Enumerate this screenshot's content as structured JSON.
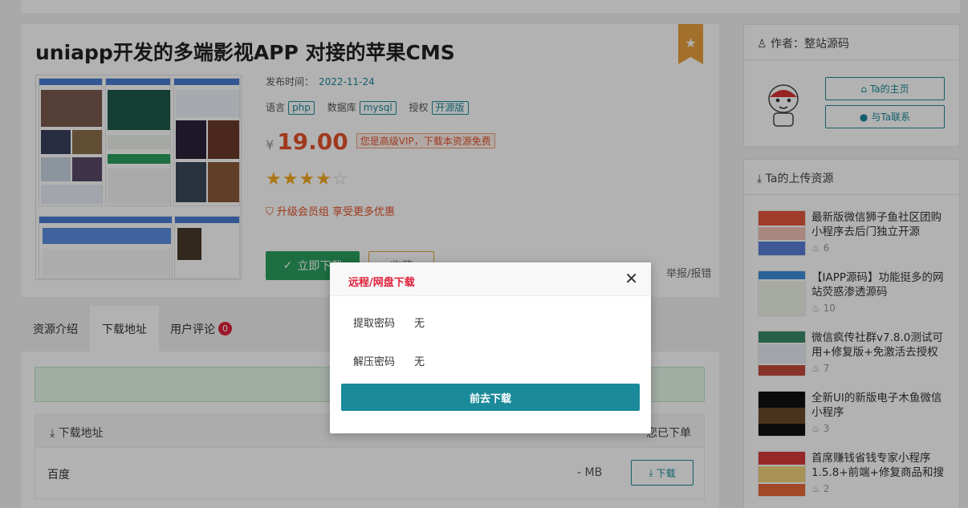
{
  "post": {
    "title": "uniapp开发的多端影视APP 对接的苹果CMS",
    "date_label": "发布时间：",
    "date_value": "2022-11-24",
    "lang_label": "语言",
    "lang_value": "php",
    "db_label": "数据库",
    "db_value": "mysql",
    "license_label": "授权",
    "license_value": "开源版",
    "currency": "¥",
    "price": "19.00",
    "vip_note": "您是高级VIP，下载本资源免费",
    "rating": 4,
    "rating_max": 5,
    "upgrade_text": "升级会员组 享受更多优惠",
    "download_button": "立即下载",
    "favorite_button": "收藏",
    "report_link": "举报/报错"
  },
  "tabs": [
    {
      "label": "资源介绍"
    },
    {
      "label": "下载地址"
    },
    {
      "label": "用户评论",
      "badge": "0"
    }
  ],
  "downloads": {
    "header_label": "下载地址",
    "header_right": "您已下单",
    "rows": [
      {
        "name": "百度",
        "size": "- MB",
        "button": "下载"
      }
    ]
  },
  "author": {
    "header": "作者：整站源码",
    "home_button": "Ta的主页",
    "contact_button": "与Ta联系"
  },
  "uploads": {
    "header": "Ta的上传资源",
    "items": [
      {
        "title": "最新版微信狮子鱼社区团购小程序去后门独立开源",
        "hot": "6"
      },
      {
        "title": "【IAPP源码】功能挺多的网站荧惑渗透源码",
        "hot": "10"
      },
      {
        "title": "微信疯传社群v7.8.0测试可用+修复版+免激活去授权",
        "hot": "7"
      },
      {
        "title": "全新UI的新版电子木鱼微信小程序",
        "hot": "3"
      },
      {
        "title": "首席赚钱省钱专家小程序1.5.8+前端+修复商品和搜",
        "hot": "2"
      }
    ]
  },
  "modal": {
    "title": "远程/网盘下载",
    "extract_label": "提取密码",
    "extract_value": "无",
    "unzip_label": "解压密码",
    "unzip_value": "无",
    "go_button": "前去下载"
  },
  "colors": {
    "accent": "#1b8a9a",
    "price": "#e4542a",
    "download_green": "#2aa05e",
    "modal_title": "#e0203b"
  }
}
